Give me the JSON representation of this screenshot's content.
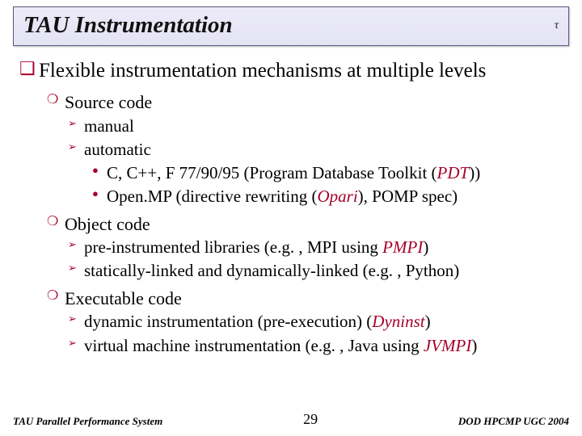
{
  "title": "TAU Instrumentation",
  "logo": "τ",
  "top": "Flexible instrumentation mechanisms at multiple levels",
  "sec1": {
    "h": "Source code",
    "a": "manual",
    "b": "automatic",
    "b1a": "C, C++, F 77/90/95 (Program Database Toolkit (",
    "b1b": "PDT",
    "b1c": "))",
    "b2a": "Open.MP (directive rewriting (",
    "b2b": "Opari",
    "b2c": "), POMP spec)"
  },
  "sec2": {
    "h": "Object code",
    "a1": "pre-instrumented libraries (e.g. , MPI using ",
    "a2": "PMPI",
    "a3": ")",
    "b": "statically-linked and dynamically-linked (e.g. , Python)"
  },
  "sec3": {
    "h": "Executable code",
    "a1": "dynamic instrumentation (pre-execution) (",
    "a2": "Dyninst",
    "a3": ")",
    "b1": "virtual machine instrumentation (e.g. , Java using ",
    "b2": "JVMPI",
    "b3": ")"
  },
  "footer": {
    "left": "TAU Parallel Performance System",
    "center": "29",
    "right": "DOD HPCMP UGC 2004"
  },
  "bullets": {
    "l1": "❑",
    "l2": "❍",
    "l3": "➢",
    "l4": "●"
  }
}
